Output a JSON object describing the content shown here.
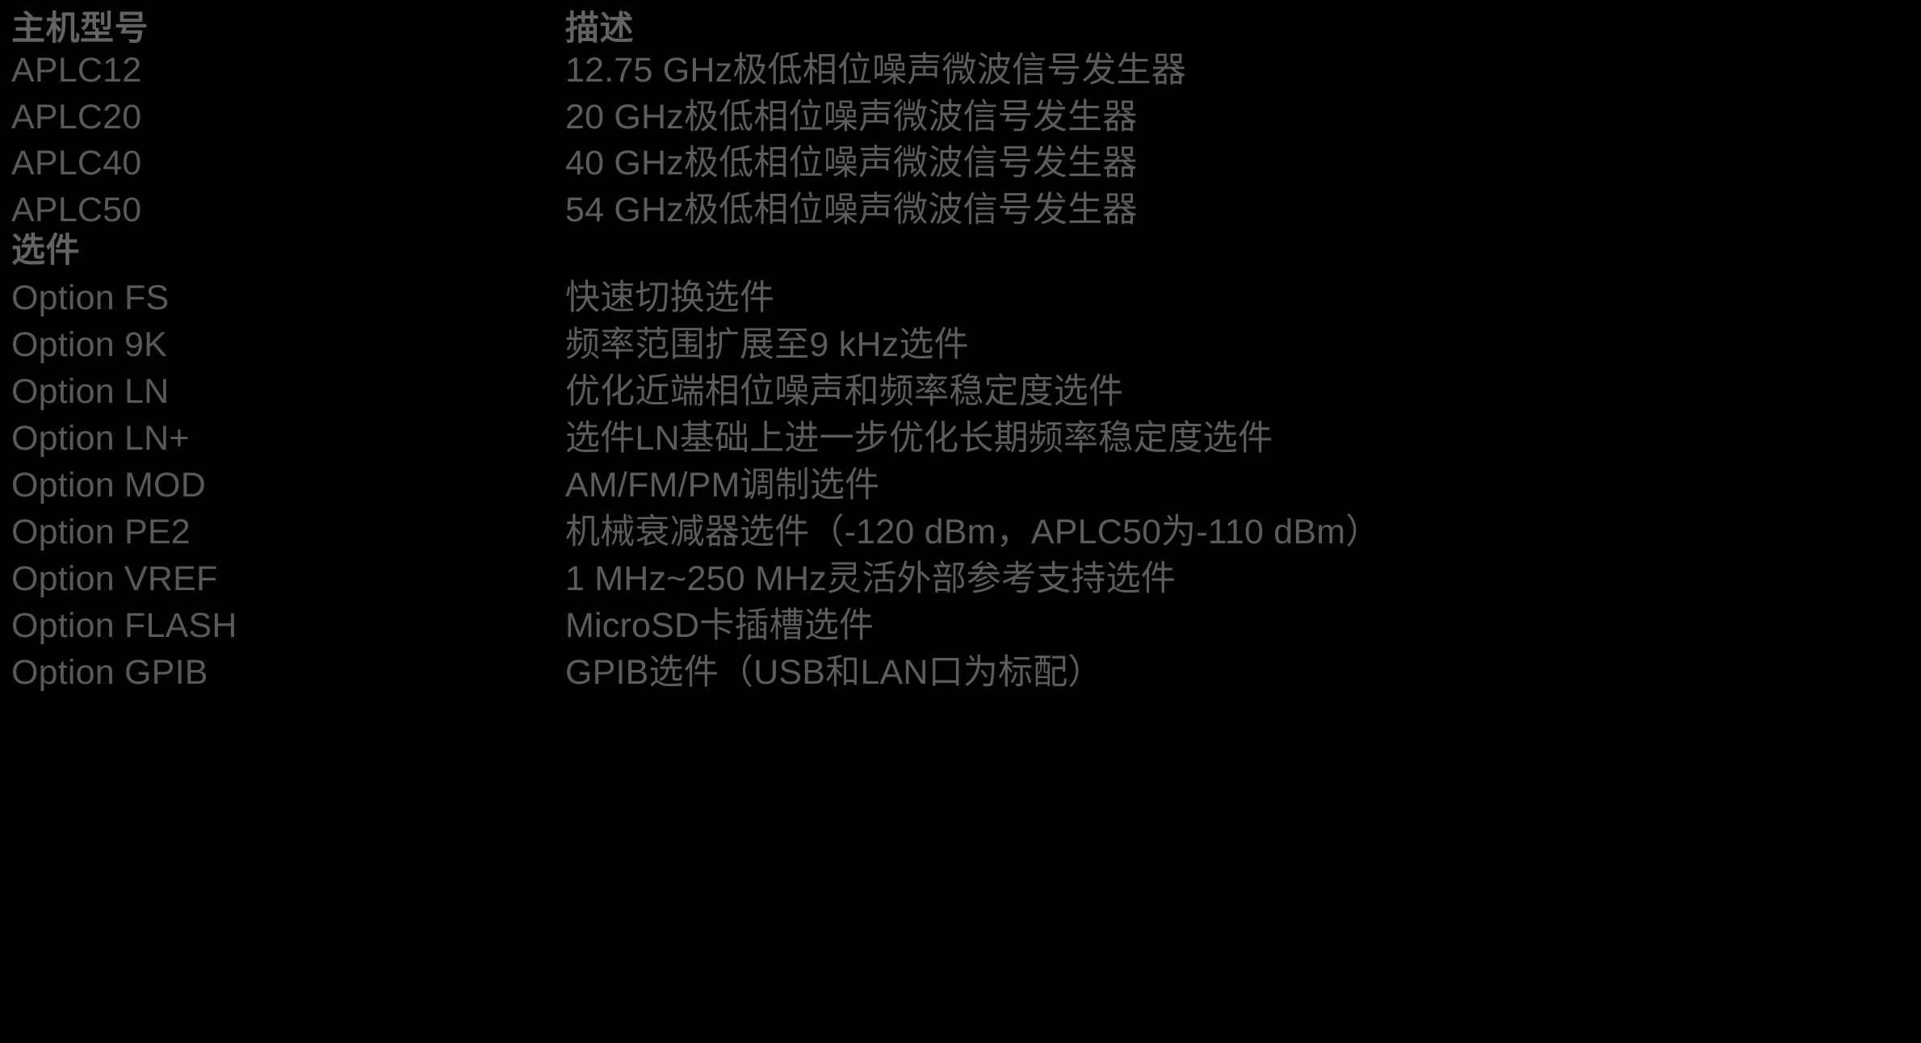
{
  "table": {
    "columns": {
      "model_header": "主机型号",
      "description_header": "描述"
    },
    "section_header": "选件",
    "models": [
      {
        "name": "APLC12",
        "description": "12.75 GHz极低相位噪声微波信号发生器"
      },
      {
        "name": "APLC20",
        "description": "20 GHz极低相位噪声微波信号发生器"
      },
      {
        "name": "APLC40",
        "description": "40 GHz极低相位噪声微波信号发生器"
      },
      {
        "name": "APLC50",
        "description": "54 GHz极低相位噪声微波信号发生器"
      }
    ],
    "options": [
      {
        "name": "Option FS",
        "description": "快速切换选件"
      },
      {
        "name": "Option 9K",
        "description": "频率范围扩展至9 kHz选件"
      },
      {
        "name": "Option LN",
        "description": "优化近端相位噪声和频率稳定度选件"
      },
      {
        "name": "Option LN+",
        "description": "选件LN基础上进一步优化长期频率稳定度选件"
      },
      {
        "name": "Option MOD",
        "description": "AM/FM/PM调制选件"
      },
      {
        "name": "Option PE2",
        "description": "机械衰减器选件（-120 dBm，APLC50为-110 dBm）"
      },
      {
        "name": "Option VREF",
        "description": "1 MHz~250 MHz灵活外部参考支持选件"
      },
      {
        "name": "Option FLASH",
        "description": "MicroSD卡插槽选件"
      },
      {
        "name": "Option GPIB",
        "description": "GPIB选件（USB和LAN口为标配）"
      }
    ]
  },
  "colors": {
    "background": "#000000",
    "header_text": "#636363",
    "body_text": "#595959"
  }
}
